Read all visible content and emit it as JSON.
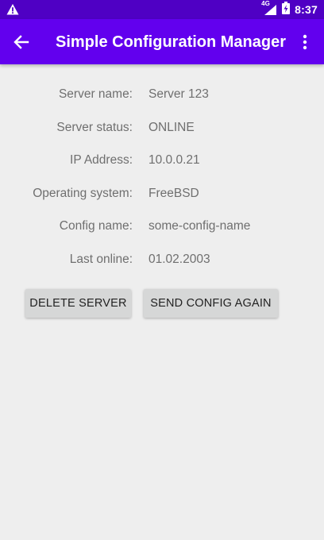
{
  "status_bar": {
    "time": "8:37",
    "network": "4G",
    "icons": [
      "warning-icon",
      "signal-icon",
      "battery-icon"
    ]
  },
  "app_bar": {
    "title": "Simple Configuration Manager",
    "back_icon": "arrow-back-icon",
    "menu_icon": "more-vert-icon"
  },
  "details": [
    {
      "label": "Server name:",
      "value": "Server 123"
    },
    {
      "label": "Server status:",
      "value": "ONLINE"
    },
    {
      "label": "IP Address:",
      "value": "10.0.0.21"
    },
    {
      "label": "Operating system:",
      "value": "FreeBSD"
    },
    {
      "label": "Config name:",
      "value": "some-config-name"
    },
    {
      "label": "Last online:",
      "value": "01.02.2003"
    }
  ],
  "buttons": {
    "delete": "DELETE SERVER",
    "send_config": "SEND CONFIG AGAIN"
  },
  "colors": {
    "status_bar": "#4f00c4",
    "app_bar": "#6200ee",
    "background": "#eeeeee",
    "button": "#d6d7d7"
  }
}
